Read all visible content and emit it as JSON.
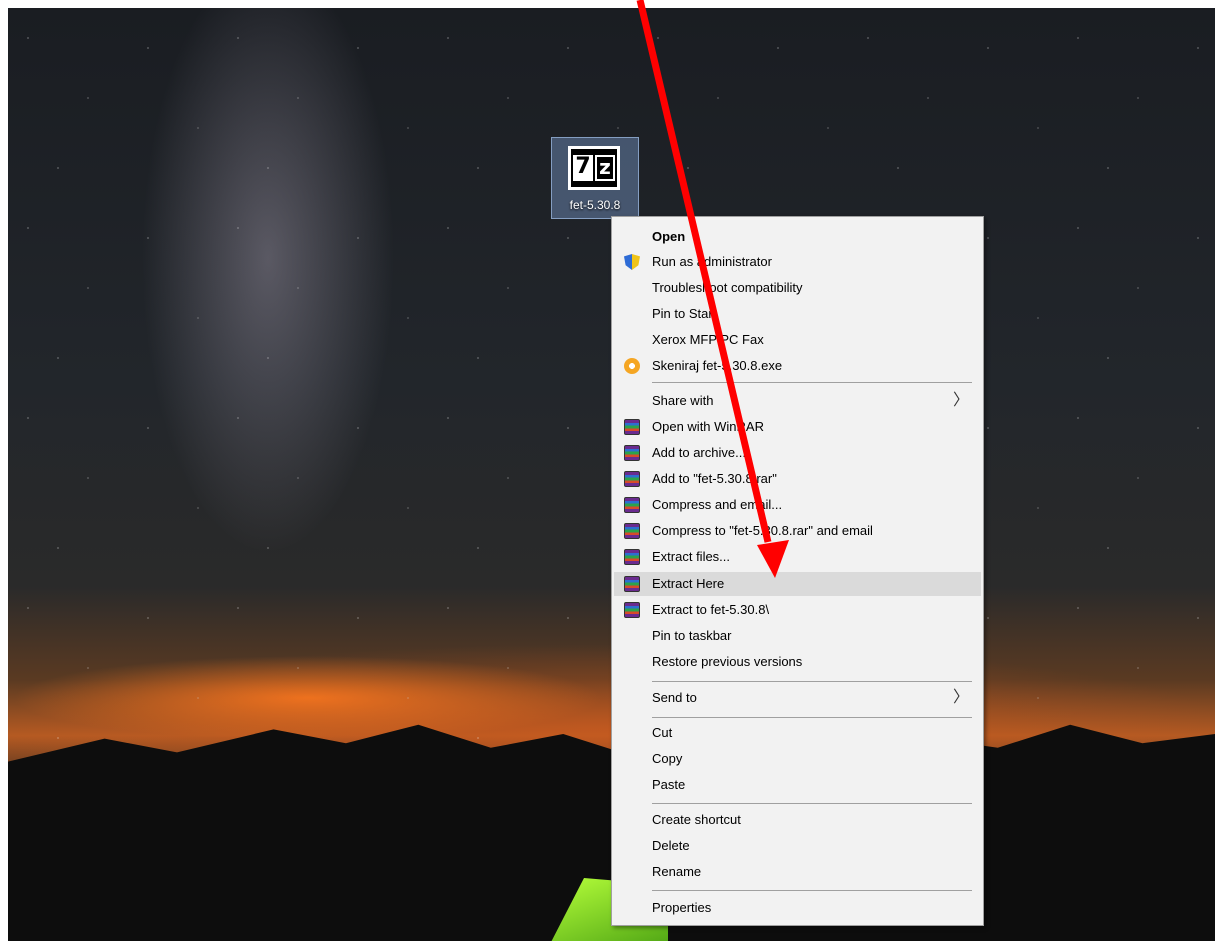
{
  "desktop": {
    "file_icon": {
      "label": "fet-5.30.8",
      "logo_left": "7",
      "logo_right": "z",
      "icon": "7zip-archive-icon"
    }
  },
  "context_menu": {
    "items": [
      {
        "label": "Open",
        "bold": true,
        "icon": ""
      },
      {
        "label": "Run as administrator",
        "icon": "uac-shield-icon"
      },
      {
        "label": "Troubleshoot compatibility",
        "icon": ""
      },
      {
        "label": "Pin to Start",
        "icon": ""
      },
      {
        "label": "Xerox MFP PC Fax",
        "icon": ""
      },
      {
        "label": "Skeniraj fet-5.30.8.exe",
        "icon": "antivirus-scan-icon"
      },
      {
        "label": "Share with",
        "icon": "",
        "submenu": true
      },
      {
        "label": "Open with WinRAR",
        "icon": "winrar-icon"
      },
      {
        "label": "Add to archive...",
        "icon": "winrar-icon"
      },
      {
        "label": "Add to \"fet-5.30.8.rar\"",
        "icon": "winrar-icon"
      },
      {
        "label": "Compress and email...",
        "icon": "winrar-icon"
      },
      {
        "label": "Compress to \"fet-5.30.8.rar\" and email",
        "icon": "winrar-icon"
      },
      {
        "label": "Extract files...",
        "icon": "winrar-icon"
      },
      {
        "label": "Extract Here",
        "icon": "winrar-icon",
        "highlighted": true
      },
      {
        "label": "Extract to fet-5.30.8\\",
        "icon": "winrar-icon"
      },
      {
        "label": "Pin to taskbar",
        "icon": ""
      },
      {
        "label": "Restore previous versions",
        "icon": ""
      },
      {
        "label": "Send to",
        "icon": "",
        "submenu": true
      },
      {
        "label": "Cut",
        "icon": ""
      },
      {
        "label": "Copy",
        "icon": ""
      },
      {
        "label": "Paste",
        "icon": ""
      },
      {
        "label": "Create shortcut",
        "icon": ""
      },
      {
        "label": "Delete",
        "icon": ""
      },
      {
        "label": "Rename",
        "icon": ""
      },
      {
        "label": "Properties",
        "icon": ""
      }
    ],
    "submenu_glyph": "〉"
  },
  "annotation": {
    "arrow_color": "#ff0000"
  },
  "colors": {
    "menu_bg": "#f2f2f2",
    "highlight": "#dadada",
    "separator": "#a0a0a0"
  }
}
